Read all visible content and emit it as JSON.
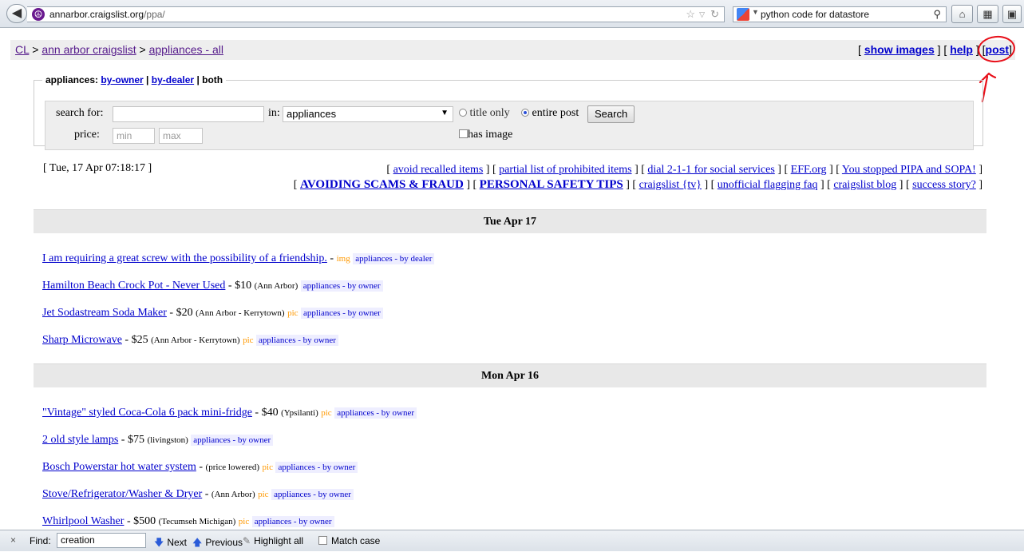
{
  "browser": {
    "url_host": "annarbor.craigslist.org",
    "url_path": "/ppa/",
    "search_text": "python code for datastore"
  },
  "breadcrumbs": {
    "root": "CL",
    "sep1": " > ",
    "city": "ann arbor craigslist",
    "sep2": " > ",
    "section": "appliances - all"
  },
  "top_links": {
    "show_images": "show images",
    "help": "help",
    "post": "post"
  },
  "search": {
    "legend_prefix": "appliances:",
    "by_owner": "by-owner",
    "by_dealer": "by-dealer",
    "both": "both",
    "search_for_label": "search for:",
    "in_label": "in:",
    "category_value": "appliances",
    "title_only_label": "title only",
    "entire_post_label": "entire post",
    "search_button": "Search",
    "price_label": "price:",
    "min_placeholder": "min",
    "max_placeholder": "max",
    "has_image_label": "has image"
  },
  "datestamp": "[ Tue, 17 Apr 07:18:17 ]",
  "links_row1": [
    "avoid recalled items",
    "partial list of prohibited items",
    "dial 2-1-1 for social services",
    "EFF.org",
    "You stopped PIPA and SOPA!"
  ],
  "links_row2": [
    "AVOIDING SCAMS & FRAUD",
    "PERSONAL SAFETY TIPS",
    "craigslist {tv}",
    "unofficial flagging faq",
    "craigslist blog",
    "success story?"
  ],
  "days": [
    {
      "header": "Tue Apr 17",
      "listings": [
        {
          "title": "I am requiring a great screw with the possibility of a friendship.",
          "price": "",
          "location": "",
          "pic": "img",
          "category": "appliances - by dealer"
        },
        {
          "title": "Hamilton Beach Crock Pot - Never Used",
          "price": "$10",
          "location": "(Ann Arbor)",
          "pic": "",
          "category": "appliances - by owner"
        },
        {
          "title": "Jet Sodastream Soda Maker",
          "price": "$20",
          "location": "(Ann Arbor - Kerrytown)",
          "pic": "pic",
          "category": "appliances - by owner"
        },
        {
          "title": "Sharp Microwave",
          "price": "$25",
          "location": "(Ann Arbor - Kerrytown)",
          "pic": "pic",
          "category": "appliances - by owner"
        }
      ]
    },
    {
      "header": "Mon Apr 16",
      "listings": [
        {
          "title": "\"Vintage\" styled Coca-Cola 6 pack mini-fridge",
          "price": "$40",
          "location": "(Ypsilanti)",
          "pic": "pic",
          "category": "appliances - by owner"
        },
        {
          "title": "2 old style lamps",
          "price": "$75",
          "location": "(livingston)",
          "pic": "",
          "category": "appliances - by owner"
        },
        {
          "title": "Bosch Powerstar hot water system",
          "price": "",
          "location": "(price lowered)",
          "pic": "pic",
          "category": "appliances - by owner"
        },
        {
          "title": "Stove/Refrigerator/Washer & Dryer",
          "price": "",
          "location": "(Ann Arbor)",
          "pic": "pic",
          "category": "appliances - by owner"
        },
        {
          "title": "Whirlpool Washer",
          "price": "$500",
          "location": "(Tecumseh Michigan)",
          "pic": "pic",
          "category": "appliances - by owner"
        }
      ]
    }
  ],
  "findbar": {
    "close": "×",
    "label": "Find:",
    "value": "creation",
    "next": "Next",
    "previous": "Previous",
    "highlight_all": "Highlight all",
    "match_case": "Match case"
  },
  "colors": {
    "link": "#0000cc",
    "visited": "#551a8b",
    "pic": "#ff9900",
    "annotation": "#e8101a"
  }
}
